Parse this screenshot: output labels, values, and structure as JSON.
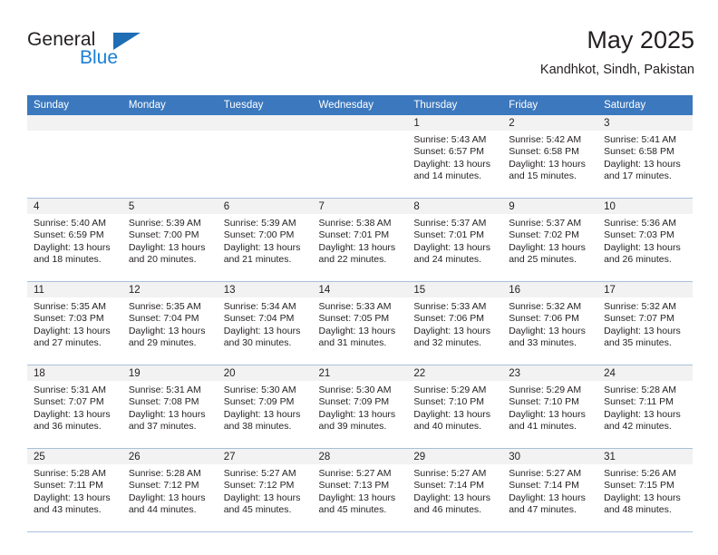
{
  "brand": {
    "name_part1": "General",
    "name_part2": "Blue",
    "logo_icon": "triangle-flag-icon",
    "accent_color": "#1f6db5",
    "blue_text_color": "#1a7fd4"
  },
  "header": {
    "title": "May 2025",
    "subtitle": "Kandhkot, Sindh, Pakistan"
  },
  "calendar": {
    "header_bg": "#3b78be",
    "header_text_color": "#ffffff",
    "daynum_strip_bg": "#f2f2f2",
    "row_divider_color": "#a9c0da",
    "weekday_headers": [
      "Sunday",
      "Monday",
      "Tuesday",
      "Wednesday",
      "Thursday",
      "Friday",
      "Saturday"
    ],
    "weeks": [
      [
        {
          "day": "",
          "sunrise": "",
          "sunset": "",
          "daylight": "",
          "empty": true
        },
        {
          "day": "",
          "sunrise": "",
          "sunset": "",
          "daylight": "",
          "empty": true
        },
        {
          "day": "",
          "sunrise": "",
          "sunset": "",
          "daylight": "",
          "empty": true
        },
        {
          "day": "",
          "sunrise": "",
          "sunset": "",
          "daylight": "",
          "empty": true
        },
        {
          "day": "1",
          "sunrise": "Sunrise: 5:43 AM",
          "sunset": "Sunset: 6:57 PM",
          "daylight": "Daylight: 13 hours and 14 minutes.",
          "empty": false
        },
        {
          "day": "2",
          "sunrise": "Sunrise: 5:42 AM",
          "sunset": "Sunset: 6:58 PM",
          "daylight": "Daylight: 13 hours and 15 minutes.",
          "empty": false
        },
        {
          "day": "3",
          "sunrise": "Sunrise: 5:41 AM",
          "sunset": "Sunset: 6:58 PM",
          "daylight": "Daylight: 13 hours and 17 minutes.",
          "empty": false
        }
      ],
      [
        {
          "day": "4",
          "sunrise": "Sunrise: 5:40 AM",
          "sunset": "Sunset: 6:59 PM",
          "daylight": "Daylight: 13 hours and 18 minutes.",
          "empty": false
        },
        {
          "day": "5",
          "sunrise": "Sunrise: 5:39 AM",
          "sunset": "Sunset: 7:00 PM",
          "daylight": "Daylight: 13 hours and 20 minutes.",
          "empty": false
        },
        {
          "day": "6",
          "sunrise": "Sunrise: 5:39 AM",
          "sunset": "Sunset: 7:00 PM",
          "daylight": "Daylight: 13 hours and 21 minutes.",
          "empty": false
        },
        {
          "day": "7",
          "sunrise": "Sunrise: 5:38 AM",
          "sunset": "Sunset: 7:01 PM",
          "daylight": "Daylight: 13 hours and 22 minutes.",
          "empty": false
        },
        {
          "day": "8",
          "sunrise": "Sunrise: 5:37 AM",
          "sunset": "Sunset: 7:01 PM",
          "daylight": "Daylight: 13 hours and 24 minutes.",
          "empty": false
        },
        {
          "day": "9",
          "sunrise": "Sunrise: 5:37 AM",
          "sunset": "Sunset: 7:02 PM",
          "daylight": "Daylight: 13 hours and 25 minutes.",
          "empty": false
        },
        {
          "day": "10",
          "sunrise": "Sunrise: 5:36 AM",
          "sunset": "Sunset: 7:03 PM",
          "daylight": "Daylight: 13 hours and 26 minutes.",
          "empty": false
        }
      ],
      [
        {
          "day": "11",
          "sunrise": "Sunrise: 5:35 AM",
          "sunset": "Sunset: 7:03 PM",
          "daylight": "Daylight: 13 hours and 27 minutes.",
          "empty": false
        },
        {
          "day": "12",
          "sunrise": "Sunrise: 5:35 AM",
          "sunset": "Sunset: 7:04 PM",
          "daylight": "Daylight: 13 hours and 29 minutes.",
          "empty": false
        },
        {
          "day": "13",
          "sunrise": "Sunrise: 5:34 AM",
          "sunset": "Sunset: 7:04 PM",
          "daylight": "Daylight: 13 hours and 30 minutes.",
          "empty": false
        },
        {
          "day": "14",
          "sunrise": "Sunrise: 5:33 AM",
          "sunset": "Sunset: 7:05 PM",
          "daylight": "Daylight: 13 hours and 31 minutes.",
          "empty": false
        },
        {
          "day": "15",
          "sunrise": "Sunrise: 5:33 AM",
          "sunset": "Sunset: 7:06 PM",
          "daylight": "Daylight: 13 hours and 32 minutes.",
          "empty": false
        },
        {
          "day": "16",
          "sunrise": "Sunrise: 5:32 AM",
          "sunset": "Sunset: 7:06 PM",
          "daylight": "Daylight: 13 hours and 33 minutes.",
          "empty": false
        },
        {
          "day": "17",
          "sunrise": "Sunrise: 5:32 AM",
          "sunset": "Sunset: 7:07 PM",
          "daylight": "Daylight: 13 hours and 35 minutes.",
          "empty": false
        }
      ],
      [
        {
          "day": "18",
          "sunrise": "Sunrise: 5:31 AM",
          "sunset": "Sunset: 7:07 PM",
          "daylight": "Daylight: 13 hours and 36 minutes.",
          "empty": false
        },
        {
          "day": "19",
          "sunrise": "Sunrise: 5:31 AM",
          "sunset": "Sunset: 7:08 PM",
          "daylight": "Daylight: 13 hours and 37 minutes.",
          "empty": false
        },
        {
          "day": "20",
          "sunrise": "Sunrise: 5:30 AM",
          "sunset": "Sunset: 7:09 PM",
          "daylight": "Daylight: 13 hours and 38 minutes.",
          "empty": false
        },
        {
          "day": "21",
          "sunrise": "Sunrise: 5:30 AM",
          "sunset": "Sunset: 7:09 PM",
          "daylight": "Daylight: 13 hours and 39 minutes.",
          "empty": false
        },
        {
          "day": "22",
          "sunrise": "Sunrise: 5:29 AM",
          "sunset": "Sunset: 7:10 PM",
          "daylight": "Daylight: 13 hours and 40 minutes.",
          "empty": false
        },
        {
          "day": "23",
          "sunrise": "Sunrise: 5:29 AM",
          "sunset": "Sunset: 7:10 PM",
          "daylight": "Daylight: 13 hours and 41 minutes.",
          "empty": false
        },
        {
          "day": "24",
          "sunrise": "Sunrise: 5:28 AM",
          "sunset": "Sunset: 7:11 PM",
          "daylight": "Daylight: 13 hours and 42 minutes.",
          "empty": false
        }
      ],
      [
        {
          "day": "25",
          "sunrise": "Sunrise: 5:28 AM",
          "sunset": "Sunset: 7:11 PM",
          "daylight": "Daylight: 13 hours and 43 minutes.",
          "empty": false
        },
        {
          "day": "26",
          "sunrise": "Sunrise: 5:28 AM",
          "sunset": "Sunset: 7:12 PM",
          "daylight": "Daylight: 13 hours and 44 minutes.",
          "empty": false
        },
        {
          "day": "27",
          "sunrise": "Sunrise: 5:27 AM",
          "sunset": "Sunset: 7:12 PM",
          "daylight": "Daylight: 13 hours and 45 minutes.",
          "empty": false
        },
        {
          "day": "28",
          "sunrise": "Sunrise: 5:27 AM",
          "sunset": "Sunset: 7:13 PM",
          "daylight": "Daylight: 13 hours and 45 minutes.",
          "empty": false
        },
        {
          "day": "29",
          "sunrise": "Sunrise: 5:27 AM",
          "sunset": "Sunset: 7:14 PM",
          "daylight": "Daylight: 13 hours and 46 minutes.",
          "empty": false
        },
        {
          "day": "30",
          "sunrise": "Sunrise: 5:27 AM",
          "sunset": "Sunset: 7:14 PM",
          "daylight": "Daylight: 13 hours and 47 minutes.",
          "empty": false
        },
        {
          "day": "31",
          "sunrise": "Sunrise: 5:26 AM",
          "sunset": "Sunset: 7:15 PM",
          "daylight": "Daylight: 13 hours and 48 minutes.",
          "empty": false
        }
      ]
    ]
  }
}
